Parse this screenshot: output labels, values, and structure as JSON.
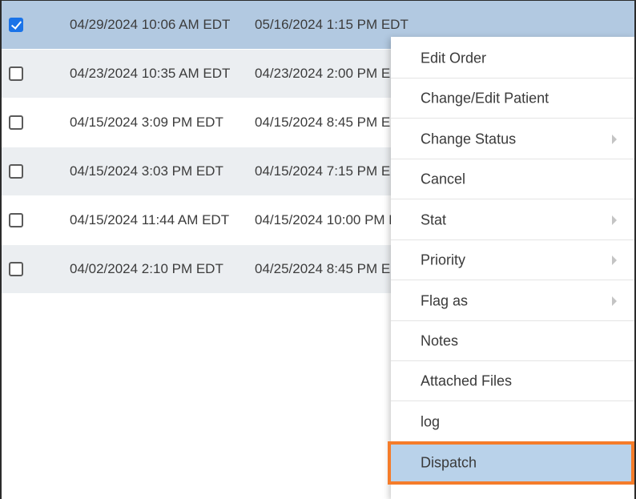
{
  "rows": [
    {
      "checked": true,
      "start": "04/29/2024 10:06 AM EDT",
      "end": "05/16/2024 1:15 PM EDT"
    },
    {
      "checked": false,
      "start": "04/23/2024 10:35 AM EDT",
      "end": "04/23/2024 2:00 PM EDT"
    },
    {
      "checked": false,
      "start": "04/15/2024 3:09 PM EDT",
      "end": "04/15/2024 8:45 PM EDT"
    },
    {
      "checked": false,
      "start": "04/15/2024 3:03 PM EDT",
      "end": "04/15/2024 7:15 PM EDT"
    },
    {
      "checked": false,
      "start": "04/15/2024 11:44 AM EDT",
      "end": "04/15/2024 10:00 PM EDT"
    },
    {
      "checked": false,
      "start": "04/02/2024 2:10 PM EDT",
      "end": "04/25/2024 8:45 PM EDT"
    }
  ],
  "context_menu": {
    "items": [
      {
        "label": "Edit Order",
        "submenu": false
      },
      {
        "label": "Change/Edit Patient",
        "submenu": false
      },
      {
        "label": "Change Status",
        "submenu": true
      },
      {
        "label": "Cancel",
        "submenu": false
      },
      {
        "label": "Stat",
        "submenu": true
      },
      {
        "label": "Priority",
        "submenu": true
      },
      {
        "label": "Flag as",
        "submenu": true
      },
      {
        "label": "Notes",
        "submenu": false
      },
      {
        "label": "Attached Files",
        "submenu": false
      },
      {
        "label": "log",
        "submenu": false
      },
      {
        "label": "Dispatch",
        "submenu": false,
        "highlighted": true
      }
    ]
  },
  "colors": {
    "selected_row": "#b2c9e1",
    "alt_row": "#ebeef1",
    "highlight_fill": "#b9d2ea",
    "highlight_border": "#f57c2a",
    "checkbox_checked": "#1a73e8"
  }
}
